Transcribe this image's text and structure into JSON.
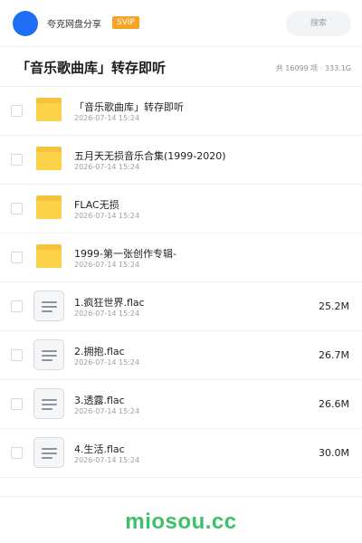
{
  "header": {
    "sharer_name": "夸克网盘分享",
    "badge": "SVIP",
    "search_placeholder": "搜索"
  },
  "folder": {
    "title": "「音乐歌曲库」转存即听",
    "stats": "共 16099 项 · 333.1G"
  },
  "files": [
    {
      "type": "folder",
      "name": "「音乐歌曲库」转存即听",
      "date": "2026-07-14 15:24",
      "size": ""
    },
    {
      "type": "folder",
      "name": "五月天无损音乐合集(1999-2020)",
      "date": "2026-07-14 15:24",
      "size": ""
    },
    {
      "type": "folder",
      "name": "FLAC无损",
      "date": "2026-07-14 15:24",
      "size": ""
    },
    {
      "type": "folder",
      "name": "1999-第一张创作专辑-",
      "date": "2026-07-14 15:24",
      "size": ""
    },
    {
      "type": "file",
      "name": "1.疯狂世界.flac",
      "date": "2026-07-14 15:24",
      "size": "25.2M"
    },
    {
      "type": "file",
      "name": "2.拥抱.flac",
      "date": "2026-07-14 15:24",
      "size": "26.7M"
    },
    {
      "type": "file",
      "name": "3.透露.flac",
      "date": "2026-07-14 15:24",
      "size": "26.6M"
    },
    {
      "type": "file",
      "name": "4.生活.flac",
      "date": "2026-07-14 15:24",
      "size": "30.0M"
    }
  ],
  "footer": {
    "watermark": "miosou.cc"
  },
  "colors": {
    "avatar": "#1e6ff5",
    "svip": "#f6a426",
    "folder": "#fcd248",
    "watermark": "#3cc06a"
  }
}
